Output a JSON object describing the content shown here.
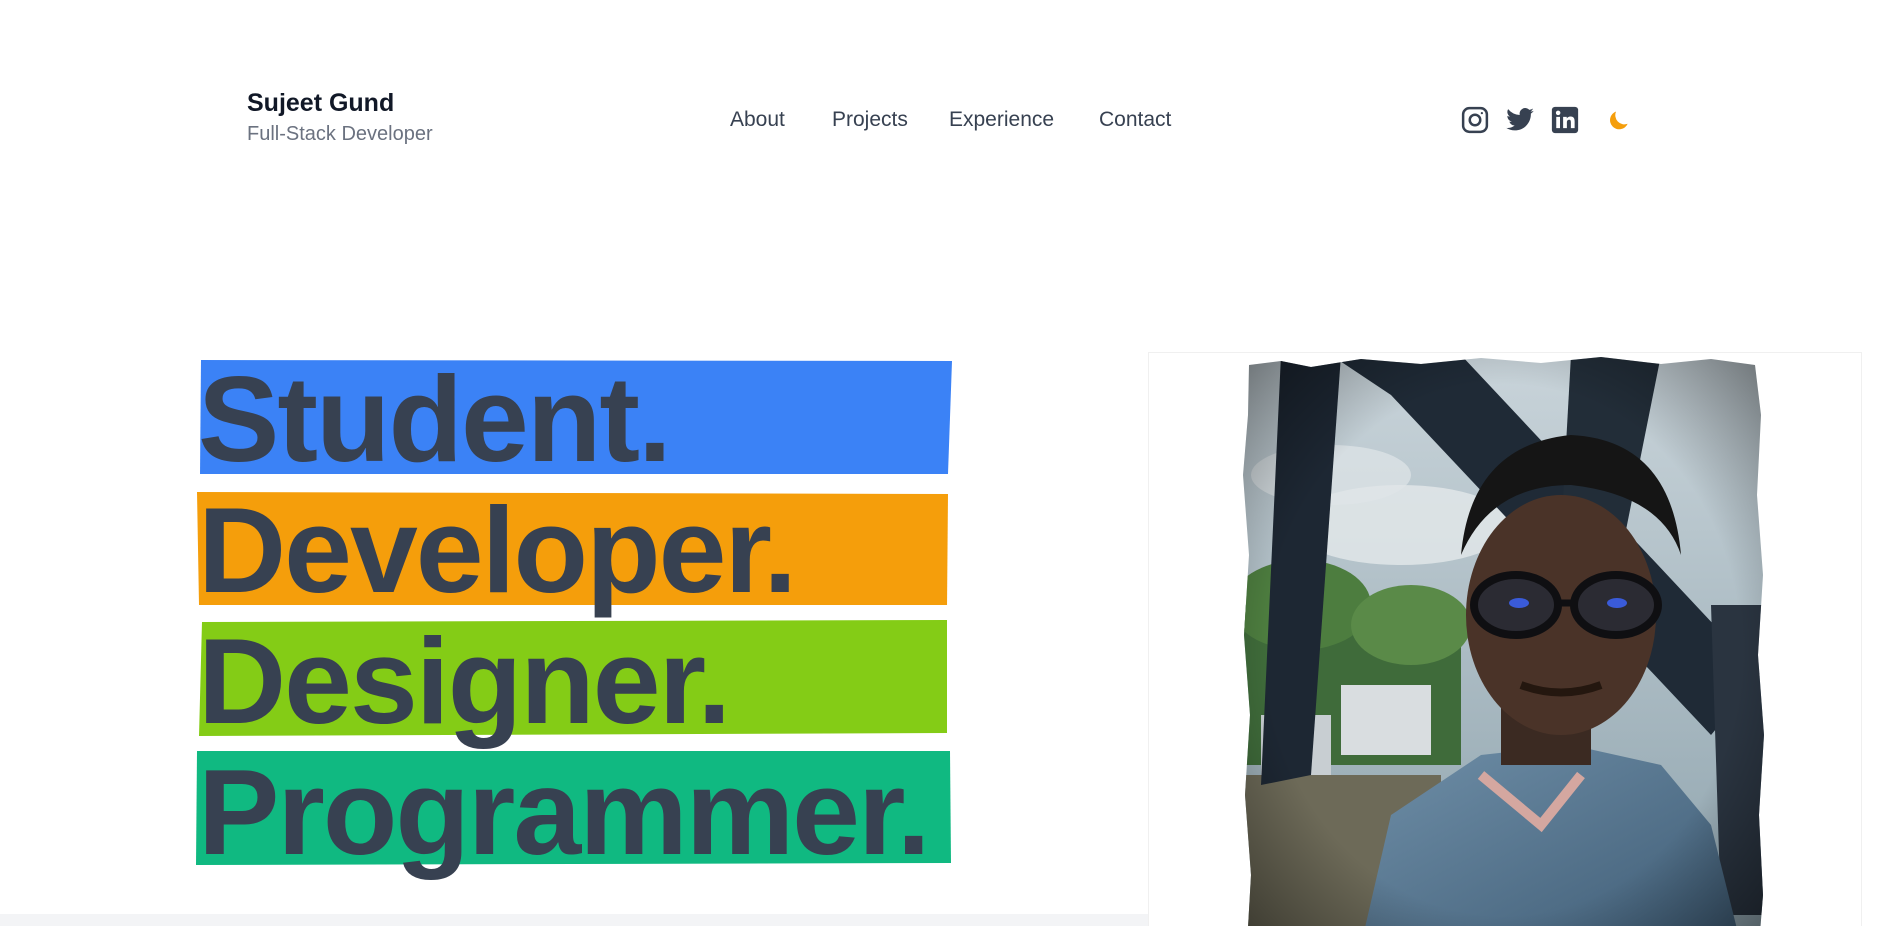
{
  "brand": {
    "name": "Sujeet Gund",
    "role": "Full-Stack Developer"
  },
  "nav": {
    "items": [
      {
        "label": "About"
      },
      {
        "label": "Projects"
      },
      {
        "label": "Experience"
      },
      {
        "label": "Contact"
      }
    ]
  },
  "socials": {
    "items": [
      {
        "icon": "instagram-icon"
      },
      {
        "icon": "twitter-icon"
      },
      {
        "icon": "linkedin-icon"
      }
    ],
    "theme_toggle_icon": "moon-icon",
    "theme_toggle_color": "#f59e0b",
    "icon_color": "#374151"
  },
  "hero": {
    "words": [
      {
        "text": "Student.",
        "color": "#3b82f6"
      },
      {
        "text": "Developer.",
        "color": "#f59e0b"
      },
      {
        "text": "Designer.",
        "color": "#84cc16"
      },
      {
        "text": "Programmer.",
        "color": "#10b981"
      }
    ],
    "text_color": "#374151"
  },
  "profile_photo": {
    "subject": "profile-photo"
  }
}
